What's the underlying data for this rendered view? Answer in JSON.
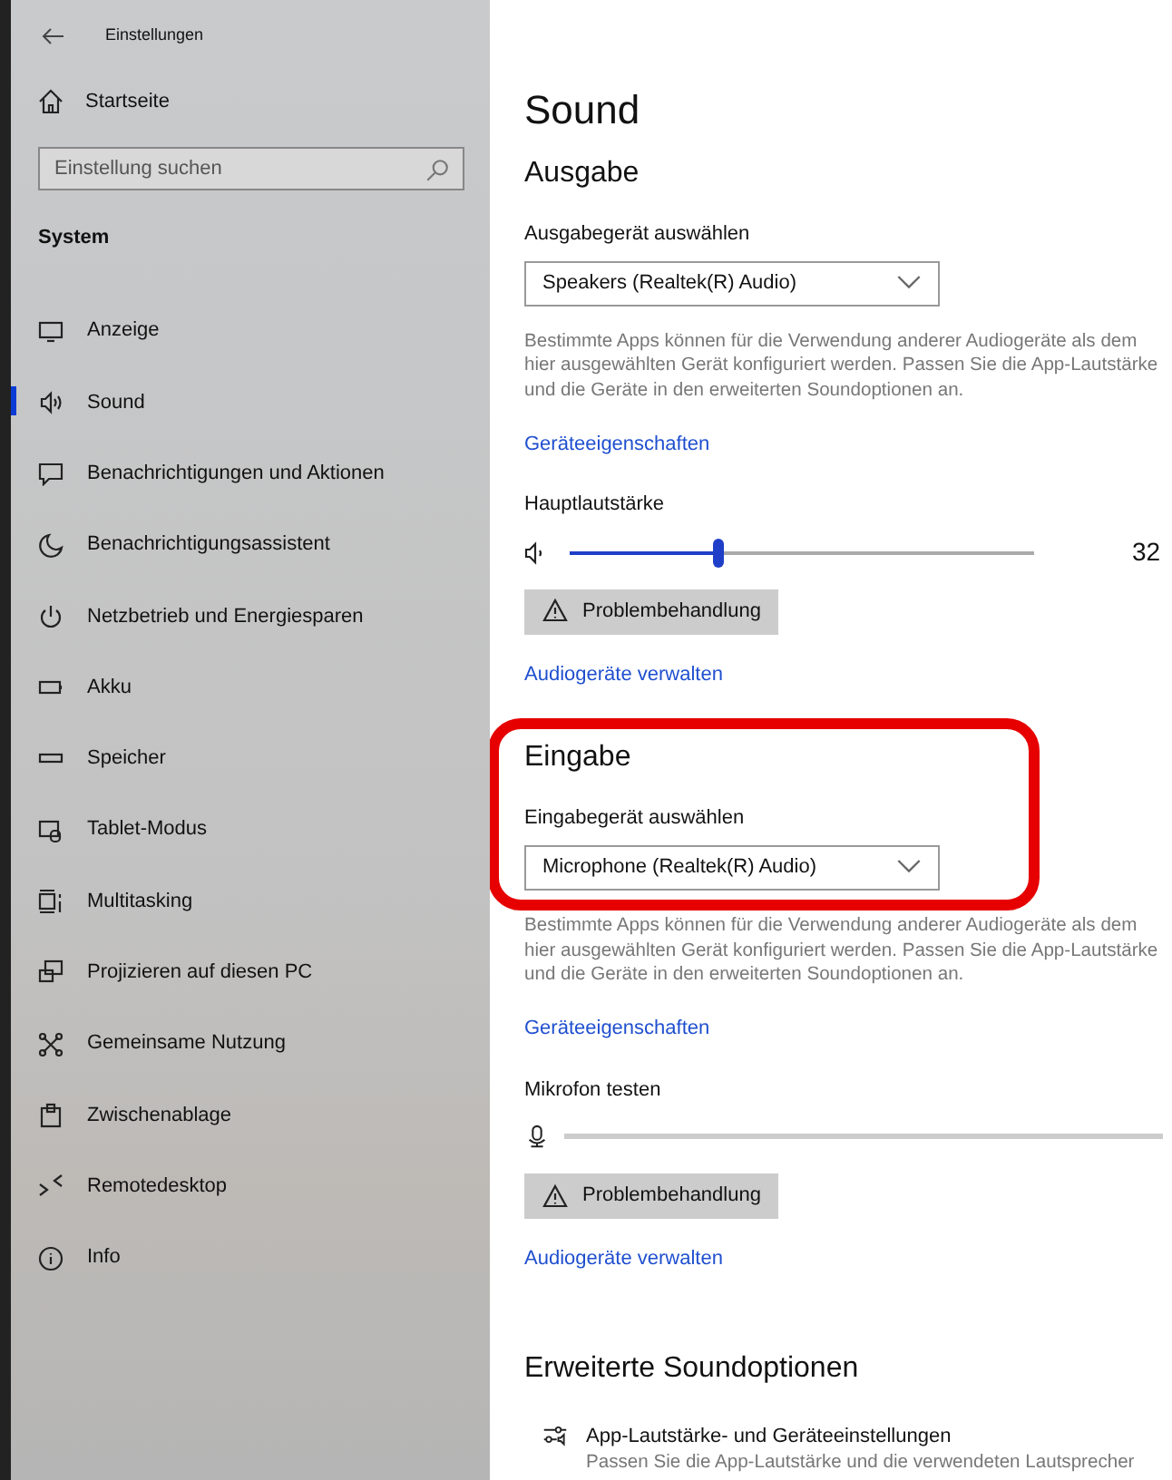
{
  "window": {
    "title": "Einstellungen"
  },
  "sidebar": {
    "home": "Startseite",
    "search": {
      "placeholder": "Einstellung suchen"
    },
    "group": "System",
    "items": [
      {
        "label": "Anzeige",
        "kind": "display",
        "selected": false
      },
      {
        "label": "Sound",
        "kind": "sound",
        "selected": true
      },
      {
        "label": "Benachrichtigungen und Aktionen",
        "kind": "notify",
        "selected": false
      },
      {
        "label": "Benachrichtigungsassistent",
        "kind": "moon",
        "selected": false
      },
      {
        "label": "Netzbetrieb und Energiesparen",
        "kind": "power",
        "selected": false
      },
      {
        "label": "Akku",
        "kind": "battery",
        "selected": false
      },
      {
        "label": "Speicher",
        "kind": "storage",
        "selected": false
      },
      {
        "label": "Tablet-Modus",
        "kind": "tablet",
        "selected": false
      },
      {
        "label": "Multitasking",
        "kind": "multitask",
        "selected": false
      },
      {
        "label": "Projizieren auf diesen PC",
        "kind": "project",
        "selected": false
      },
      {
        "label": "Gemeinsame Nutzung",
        "kind": "share",
        "selected": false
      },
      {
        "label": "Zwischenablage",
        "kind": "clipboard",
        "selected": false
      },
      {
        "label": "Remotedesktop",
        "kind": "remote",
        "selected": false
      },
      {
        "label": "Info",
        "kind": "info",
        "selected": false
      }
    ]
  },
  "page_title": "Sound",
  "sections": [
    {
      "heading": "Ausgabe",
      "highlighted": false,
      "select_label": "Ausgabegerät auswählen",
      "device": "Speakers (Realtek(R) Audio)",
      "description": "Bestimmte Apps können für die Verwendung anderer Audiogeräte als dem hier ausgewählten Gerät konfiguriert werden. Passen Sie die App-Lautstärke und die Geräte in den erweiterten Soundoptionen an.",
      "properties_link": "Geräteeigenschaften",
      "kind": "volume",
      "meter_label": "Hauptlautstärke",
      "level": 0.32,
      "reading": "32",
      "troubleshoot": "Problembehandlung",
      "manage_link": "Audiogeräte verwalten"
    },
    {
      "heading": "Eingabe",
      "highlighted": true,
      "select_label": "Eingabegerät auswählen",
      "device": "Microphone (Realtek(R) Audio)",
      "description": "Bestimmte Apps können für die Verwendung anderer Audiogeräte als dem hier ausgewählten Gerät konfiguriert werden. Passen Sie die App-Lautstärke und die Geräte in den erweiterten Soundoptionen an.",
      "properties_link": "Geräteeigenschaften",
      "kind": "mic",
      "meter_label": "Mikrofon testen",
      "troubleshoot": "Problembehandlung",
      "manage_link": "Audiogeräte verwalten"
    }
  ],
  "advanced": {
    "heading": "Erweiterte Soundoptionen",
    "item": {
      "title": "App-Lautstärke- und Geräteeinstellungen",
      "description": "Passen Sie die App-Lautstärke und die verwendeten Lautsprecher"
    }
  }
}
